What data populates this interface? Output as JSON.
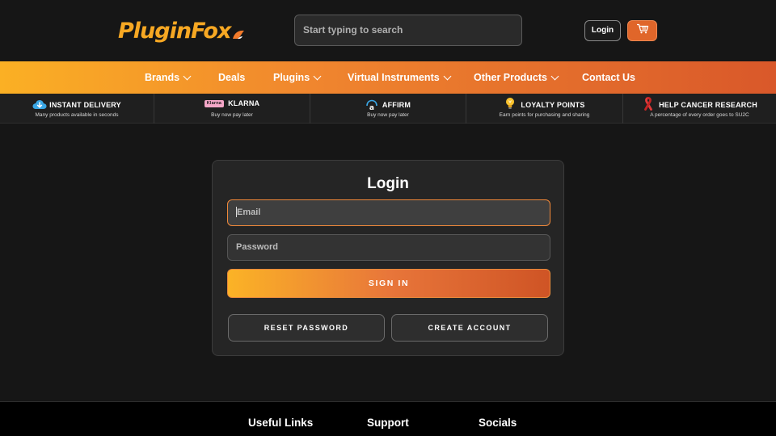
{
  "header": {
    "logo_text": "PluginFox",
    "search_placeholder": "Start typing to search",
    "login_label": "Login",
    "cart_icon": "cart-icon"
  },
  "nav": {
    "items": [
      {
        "label": "Brands",
        "has_dropdown": true
      },
      {
        "label": "Deals",
        "has_dropdown": false
      },
      {
        "label": "Plugins",
        "has_dropdown": true
      },
      {
        "label": "Virtual Instruments",
        "has_dropdown": true
      },
      {
        "label": "Other Products",
        "has_dropdown": true
      },
      {
        "label": "Contact Us",
        "has_dropdown": false
      }
    ]
  },
  "features": [
    {
      "title": "INSTANT DELIVERY",
      "subtitle": "Many products available in seconds",
      "icon": "cloud-download-icon"
    },
    {
      "title": "KLARNA",
      "subtitle": "Buy now pay later",
      "icon": "klarna-logo-icon",
      "badge": "Klarna"
    },
    {
      "title": "AFFIRM",
      "subtitle": "Buy now pay later",
      "icon": "affirm-logo-icon"
    },
    {
      "title": "LOYALTY POINTS",
      "subtitle": "Earn points for purchasing and sharing",
      "icon": "lightbulb-icon"
    },
    {
      "title": "HELP CANCER RESEARCH",
      "subtitle": "A percentage of every order goes to SU2C",
      "icon": "ribbon-icon"
    }
  ],
  "login": {
    "title": "Login",
    "email_placeholder": "Email",
    "password_placeholder": "Password",
    "sign_in_label": "SIGN IN",
    "reset_password_label": "RESET PASSWORD",
    "create_account_label": "CREATE ACCOUNT"
  },
  "footer": {
    "columns": [
      "Useful Links",
      "Support",
      "Socials"
    ]
  },
  "colors": {
    "accent_orange": "#f0862e",
    "accent_yellow": "#fbb024",
    "accent_red_orange": "#d9582a",
    "background": "#161616"
  }
}
